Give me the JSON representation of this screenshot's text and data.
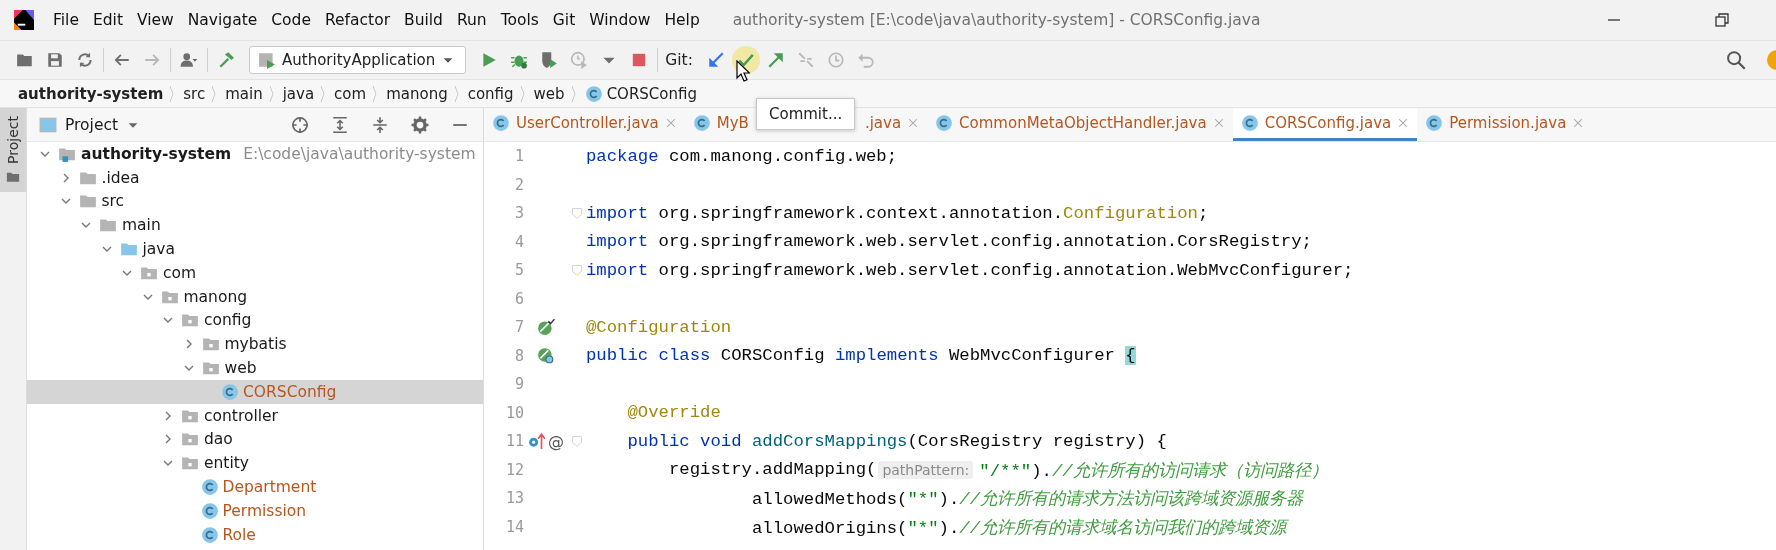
{
  "window": {
    "title": "authority-system [E:\\code\\java\\authority-system] - CORSConfig.java"
  },
  "menu": [
    "File",
    "Edit",
    "View",
    "Navigate",
    "Code",
    "Refactor",
    "Build",
    "Run",
    "Tools",
    "Git",
    "Window",
    "Help"
  ],
  "toolbar": [
    {
      "kind": "open",
      "disabled": false,
      "hovered": false
    },
    {
      "kind": "save",
      "disabled": false,
      "hovered": false
    },
    {
      "kind": "sync",
      "disabled": false,
      "hovered": false
    },
    {
      "kind": "separator"
    },
    {
      "kind": "back",
      "disabled": false,
      "hovered": false
    },
    {
      "kind": "forward",
      "disabled": true,
      "hovered": false
    },
    {
      "kind": "separator"
    },
    {
      "kind": "user",
      "disabled": false,
      "hovered": false
    },
    {
      "kind": "separator"
    },
    {
      "kind": "hammer",
      "disabled": false,
      "hovered": false
    },
    {
      "kind": "run-config",
      "label": "AuthorityApplication"
    },
    {
      "kind": "run",
      "disabled": false,
      "hovered": false
    },
    {
      "kind": "debug",
      "disabled": false,
      "hovered": false
    },
    {
      "kind": "coverage",
      "disabled": false,
      "hovered": false
    },
    {
      "kind": "profile",
      "disabled": true,
      "hovered": false
    },
    {
      "kind": "caret",
      "disabled": false,
      "hovered": false
    },
    {
      "kind": "stop",
      "disabled": false,
      "hovered": false
    },
    {
      "kind": "separator"
    },
    {
      "kind": "label",
      "text": "Git:"
    },
    {
      "kind": "update",
      "disabled": false,
      "hovered": false
    },
    {
      "kind": "commit",
      "disabled": false,
      "hovered": true
    },
    {
      "kind": "push",
      "disabled": false,
      "hovered": false
    },
    {
      "kind": "merge",
      "disabled": true,
      "hovered": false
    },
    {
      "kind": "history",
      "disabled": true,
      "hovered": false
    },
    {
      "kind": "rollback",
      "disabled": true,
      "hovered": false
    }
  ],
  "tooltip": {
    "text": "Commit..."
  },
  "breadcrumbs": [
    {
      "label": "authority-system",
      "kind": "module"
    },
    {
      "label": "src",
      "kind": "folder"
    },
    {
      "label": "main",
      "kind": "folder"
    },
    {
      "label": "java",
      "kind": "folder"
    },
    {
      "label": "com",
      "kind": "folder"
    },
    {
      "label": "manong",
      "kind": "folder"
    },
    {
      "label": "config",
      "kind": "folder"
    },
    {
      "label": "web",
      "kind": "folder"
    },
    {
      "label": "CORSConfig",
      "kind": "class"
    }
  ],
  "side_stripe": {
    "label": "Project",
    "selected": true
  },
  "project": {
    "title": "Project",
    "tree": [
      {
        "label": "authority-system",
        "path": "E:\\code\\java\\authority-system",
        "kind": "module",
        "expanded": true,
        "selected": false,
        "children": [
          {
            "label": ".idea",
            "kind": "folder",
            "expanded": false,
            "selected": false
          },
          {
            "label": "src",
            "kind": "folder",
            "expanded": true,
            "selected": false,
            "children": [
              {
                "label": "main",
                "kind": "folder",
                "expanded": true,
                "selected": false,
                "children": [
                  {
                    "label": "java",
                    "kind": "source",
                    "expanded": true,
                    "selected": false,
                    "children": [
                      {
                        "label": "com",
                        "kind": "package",
                        "expanded": true,
                        "selected": false,
                        "children": [
                          {
                            "label": "manong",
                            "kind": "package",
                            "expanded": true,
                            "selected": false,
                            "children": [
                              {
                                "label": "config",
                                "kind": "package",
                                "expanded": true,
                                "selected": false,
                                "children": [
                                  {
                                    "label": "mybatis",
                                    "kind": "package",
                                    "expanded": false,
                                    "selected": false
                                  },
                                  {
                                    "label": "web",
                                    "kind": "package",
                                    "expanded": true,
                                    "selected": false,
                                    "children": [
                                      {
                                        "label": "CORSConfig",
                                        "kind": "class",
                                        "selected": true
                                      }
                                    ]
                                  }
                                ]
                              },
                              {
                                "label": "controller",
                                "kind": "package",
                                "expanded": false,
                                "selected": false
                              },
                              {
                                "label": "dao",
                                "kind": "package",
                                "expanded": false,
                                "selected": false
                              },
                              {
                                "label": "entity",
                                "kind": "package",
                                "expanded": true,
                                "selected": false,
                                "children": [
                                  {
                                    "label": "Department",
                                    "kind": "class",
                                    "selected": false
                                  },
                                  {
                                    "label": "Permission",
                                    "kind": "class",
                                    "selected": false
                                  },
                                  {
                                    "label": "Role",
                                    "kind": "class",
                                    "selected": false
                                  }
                                ]
                              }
                            ]
                          }
                        ]
                      }
                    ]
                  }
                ]
              }
            ]
          }
        ]
      }
    ]
  },
  "editor": {
    "tabs": [
      {
        "label": "UserController.java",
        "selected": false
      },
      {
        "label": "MyB",
        "label_end": ".java",
        "selected": false
      },
      {
        "label": "CommonMetaObjectHandler.java",
        "selected": false
      },
      {
        "label": "CORSConfig.java",
        "selected": true
      },
      {
        "label": "Permission.java",
        "selected": false
      }
    ],
    "lines": [
      {
        "number": "1",
        "tokens": [
          {
            "kind": "kw",
            "text": "package"
          },
          {
            "kind": "plain",
            "text": " com.manong.config.web;"
          }
        ]
      },
      {
        "number": "2"
      },
      {
        "number": "3",
        "fold": true,
        "tokens": [
          {
            "kind": "kw",
            "text": "import"
          },
          {
            "kind": "plain",
            "text": " org.springframework.context.annotation."
          },
          {
            "kind": "annotation",
            "text": "Configuration"
          },
          {
            "kind": "plain",
            "text": ";"
          }
        ]
      },
      {
        "number": "4",
        "tokens": [
          {
            "kind": "kw",
            "text": "import"
          },
          {
            "kind": "plain",
            "text": " org.springframework.web.servlet.config.annotation.CorsRegistry;"
          }
        ]
      },
      {
        "number": "5",
        "fold": true,
        "tokens": [
          {
            "kind": "kw",
            "text": "import"
          },
          {
            "kind": "plain",
            "text": " org.springframework.web.servlet.config.annotation.WebMvcConfigurer;"
          }
        ]
      },
      {
        "number": "6"
      },
      {
        "number": "7",
        "kind": "bean",
        "tokens": [
          {
            "kind": "annotation",
            "text": "@Configuration"
          }
        ]
      },
      {
        "number": "8",
        "kind": "bean-class",
        "tokens": [
          {
            "kind": "kw",
            "text": "public class"
          },
          {
            "kind": "plain",
            "text": " CORSConfig "
          },
          {
            "kind": "kw",
            "text": "implements"
          },
          {
            "kind": "plain",
            "text": " WebMvcConfigurer "
          },
          {
            "kind": "brace",
            "text": "{"
          }
        ]
      },
      {
        "number": "9"
      },
      {
        "number": "10",
        "tokens": [
          {
            "kind": "annotation",
            "text": "    @Override"
          }
        ]
      },
      {
        "number": "11",
        "kind": "override",
        "gutter_text": "@",
        "fold": true,
        "tokens": [
          {
            "kind": "kw",
            "text": "    public void"
          },
          {
            "kind": "method",
            "text": " addCorsMappings"
          },
          {
            "kind": "plain",
            "text": "(CorsRegistry registry) {"
          }
        ]
      },
      {
        "number": "12",
        "tokens": [
          {
            "kind": "plain",
            "text": "        registry.addMapping("
          },
          {
            "kind": "hint",
            "text": "pathPattern:"
          },
          {
            "kind": "string",
            "text": "\"/**\""
          },
          {
            "kind": "plain",
            "text": ")."
          },
          {
            "kind": "comment",
            "text": "//允许所有的访问请求（访问路径）"
          }
        ]
      },
      {
        "number": "13",
        "tokens": [
          {
            "kind": "plain",
            "text": "                allowedMethods("
          },
          {
            "kind": "string",
            "text": "\"*\""
          },
          {
            "kind": "plain",
            "text": ")."
          },
          {
            "kind": "comment",
            "text": "//允许所有的请求方法访问该跨域资源服务器"
          }
        ]
      },
      {
        "number": "14",
        "tokens": [
          {
            "kind": "plain",
            "text": "                allowedOrigins("
          },
          {
            "kind": "string",
            "text": "\"*\""
          },
          {
            "kind": "plain",
            "text": ")."
          },
          {
            "kind": "comment",
            "text": "//允许所有的请求域名访问我们的跨域资源"
          }
        ]
      }
    ]
  }
}
